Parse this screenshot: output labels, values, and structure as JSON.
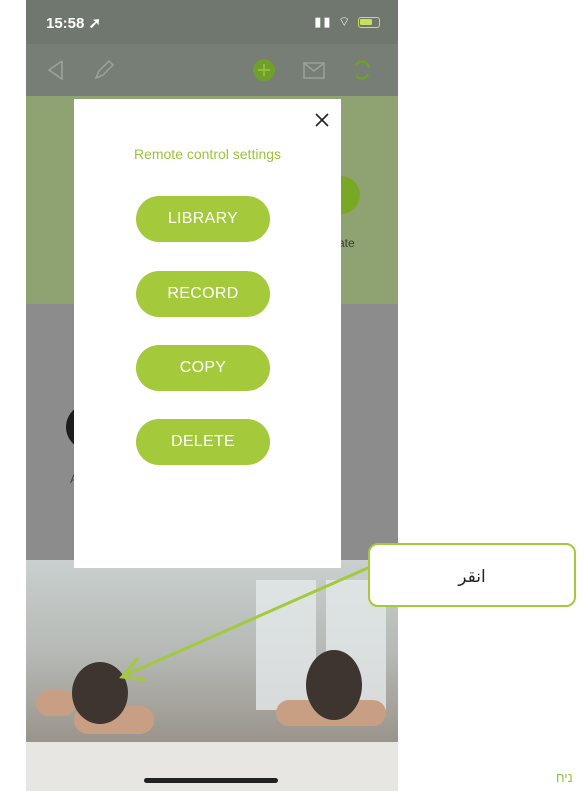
{
  "status_bar": {
    "time": "15:58",
    "icons": [
      "location-arrow-icon",
      "signal-icon",
      "wifi-icon",
      "battery-icon"
    ]
  },
  "toolbar": {
    "icons": [
      "back-icon",
      "edit-pencil-icon",
      "add-circle-icon",
      "mail-icon",
      "refresh-icon"
    ]
  },
  "background": {
    "band_text": "ate",
    "mid_text": "A"
  },
  "modal": {
    "title": "Remote control settings",
    "close_icon": "close-icon",
    "buttons": [
      "LIBRARY",
      "RECORD",
      "COPY",
      "DELETE"
    ]
  },
  "callout": {
    "text": "انقر"
  },
  "corner_text": "ניח",
  "colors": {
    "accent_green": "#a4c93a",
    "title_green": "#9bc33a"
  }
}
